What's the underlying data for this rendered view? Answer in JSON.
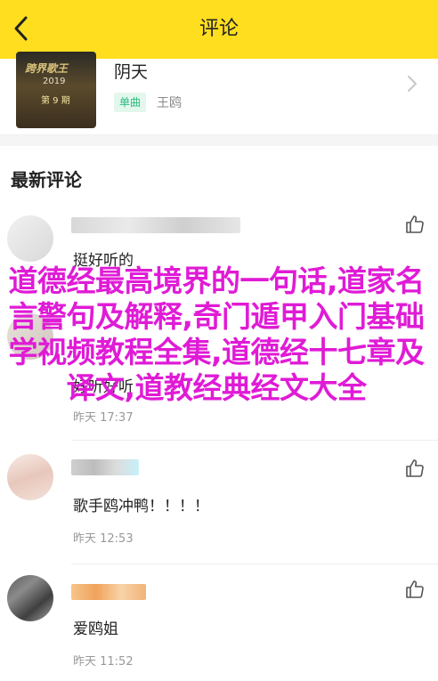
{
  "header": {
    "title": "评论"
  },
  "song": {
    "title": "阴天",
    "tag": "单曲",
    "artist": "王鸥",
    "cover_text_1": "跨界歌王",
    "cover_text_2": "2019",
    "cover_text_3": "第 9 期"
  },
  "section_title": "最新评论",
  "comments": [
    {
      "text": "挺好听的",
      "time": ""
    },
    {
      "text": "好听好听",
      "time": "昨天 17:37"
    },
    {
      "text": "歌手鸥冲鸭！！！！",
      "time": "昨天 12:53"
    },
    {
      "text": "爱鸥姐",
      "time": "昨天 11:52"
    }
  ],
  "overlay_text": "道德经最高境界的一句话,道家名言警句及解释,奇门遁甲入门基础学视频教程全集,道德经十七章及译文,道教经典经文大全",
  "colors": {
    "header": "#ffde1f",
    "overlay": "#e01bd6",
    "tag_text": "#2bbd7e"
  },
  "icons": {
    "back": "chevron-left-icon",
    "like": "thumbs-up-icon",
    "more": "chevron-right-icon"
  }
}
